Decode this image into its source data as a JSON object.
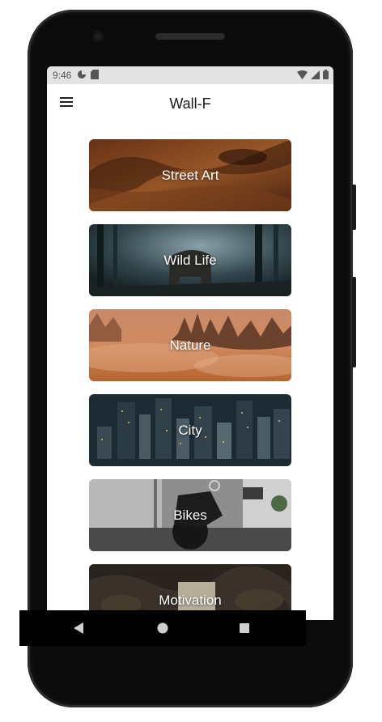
{
  "status_bar": {
    "time": "9:46"
  },
  "app_bar": {
    "title": "Wall-F"
  },
  "categories": [
    {
      "label": "Street Art",
      "icon": "street-art-image"
    },
    {
      "label": "Wild Life",
      "icon": "wild-life-image"
    },
    {
      "label": "Nature",
      "icon": "nature-image"
    },
    {
      "label": "City",
      "icon": "city-image"
    },
    {
      "label": "Bikes",
      "icon": "bikes-image"
    },
    {
      "label": "Motivation",
      "icon": "motivation-image"
    }
  ],
  "nav_bar": {
    "back_icon": "back-triangle-icon",
    "home_icon": "home-circle-icon",
    "recents_icon": "recents-square-icon"
  }
}
